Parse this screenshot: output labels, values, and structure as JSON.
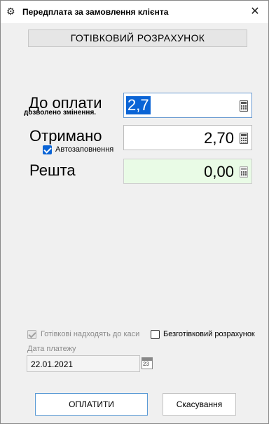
{
  "window": {
    "title": "Передплата за замовлення клієнта",
    "title_icon": "gear-icon",
    "close_glyph": "✕"
  },
  "payment_type_button": "ГОТІВКОВИЙ РОЗРАХУНОК",
  "due": {
    "label": "До оплати",
    "note": "дозволено змінення.",
    "value": "2,7"
  },
  "received": {
    "label": "Отримано",
    "value": "2,70",
    "autofill_label": "Автозаповнення",
    "autofill_checked": true
  },
  "change": {
    "label": "Решта",
    "value": "0,00"
  },
  "options": {
    "cash_to_register_label": "Готівкові надходять до каси",
    "cash_to_register_checked": true,
    "cashless_label": "Безготівковий розрахунок",
    "cashless_checked": false
  },
  "payment_date": {
    "caption": "Дата платежу",
    "value": "22.01.2021",
    "calendar_day": "23"
  },
  "buttons": {
    "pay": "ОПЛАТИТИ",
    "cancel": "Скасування"
  },
  "colors": {
    "selection": "#0a64d6",
    "change_field_bg": "#e9fbe6",
    "primary_border": "#5b9bd5"
  }
}
